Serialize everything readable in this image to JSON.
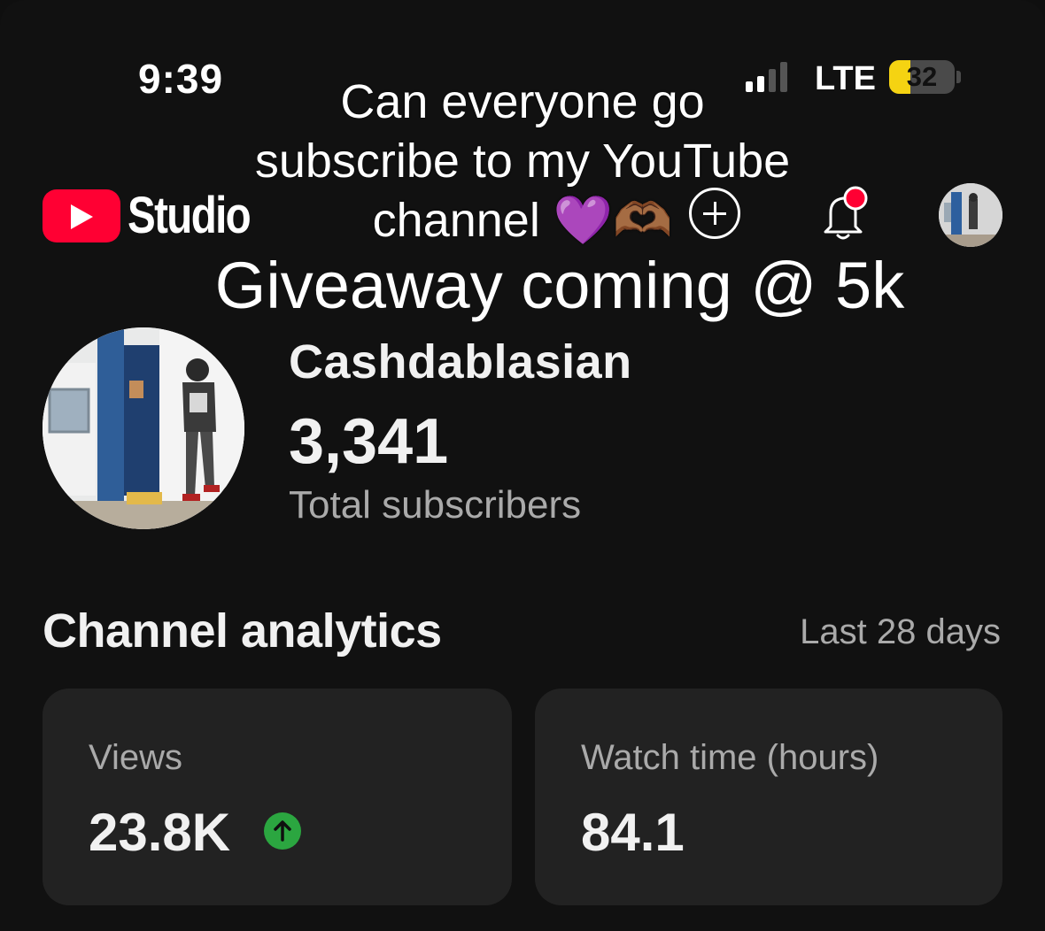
{
  "status_bar": {
    "time": "9:39",
    "network": "LTE",
    "battery_percent": "32",
    "battery_level": 0.32,
    "battery_color": "#f5d312"
  },
  "app_bar": {
    "logo_text": "Studio",
    "logo_color": "#ff0033",
    "create_icon": "plus-circle-icon",
    "notification_icon": "bell-icon",
    "notification_dot_color": "#ff0033"
  },
  "overlay": {
    "caption_line1": "Can everyone go",
    "caption_line2": "subscribe to my YouTube",
    "caption_line3": "channel 💜🫶🏾",
    "giveaway": "Giveaway coming @ 5k"
  },
  "channel": {
    "name": "Cashdablasian",
    "subscriber_count": "3,341",
    "subscriber_label": "Total subscribers"
  },
  "analytics": {
    "title": "Channel analytics",
    "range": "Last 28 days",
    "cards": [
      {
        "label": "Views",
        "value": "23.8K",
        "trend": "up",
        "trend_color": "#2ba640"
      },
      {
        "label": "Watch time (hours)",
        "value": "84.1"
      }
    ]
  }
}
